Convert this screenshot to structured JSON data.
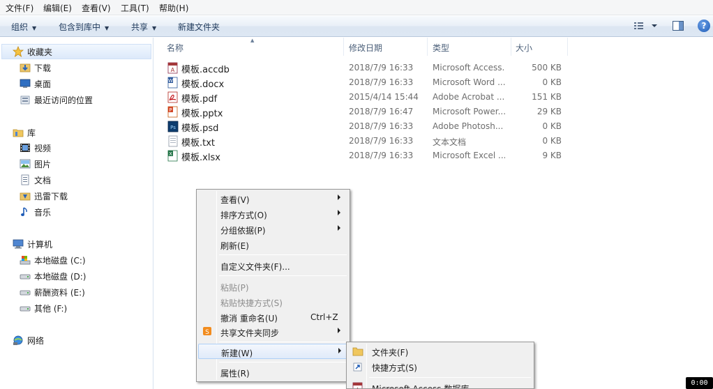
{
  "menubar": {
    "items": [
      "文件(F)",
      "编辑(E)",
      "查看(V)",
      "工具(T)",
      "帮助(H)"
    ]
  },
  "commandbar": {
    "organize": "组织",
    "include_in_library": "包含到库中",
    "share": "共享",
    "new_folder": "新建文件夹",
    "help": "?"
  },
  "nav": {
    "favorites": "收藏夹",
    "downloads": "下载",
    "desktop": "桌面",
    "recent": "最近访问的位置",
    "libraries": "库",
    "videos": "视频",
    "pictures": "图片",
    "documents": "文档",
    "thunder": "迅雷下载",
    "music": "音乐",
    "computer": "计算机",
    "drive_c": "本地磁盘 (C:)",
    "drive_d": "本地磁盘 (D:)",
    "drive_e": "薪酬资料 (E:)",
    "drive_f": "其他 (F:)",
    "network": "网络"
  },
  "columns": {
    "name": "名称",
    "modified": "修改日期",
    "type": "类型",
    "size": "大小"
  },
  "files": [
    {
      "name": "模板.accdb",
      "date": "2018/7/9 16:33",
      "type": "Microsoft Access...",
      "size": "500 KB",
      "icon": "access-icon"
    },
    {
      "name": "模板.docx",
      "date": "2018/7/9 16:33",
      "type": "Microsoft Word ...",
      "size": "0 KB",
      "icon": "word-icon"
    },
    {
      "name": "模板.pdf",
      "date": "2015/4/14 15:44",
      "type": "Adobe Acrobat ...",
      "size": "151 KB",
      "icon": "pdf-icon"
    },
    {
      "name": "模板.pptx",
      "date": "2018/7/9 16:47",
      "type": "Microsoft Power...",
      "size": "29 KB",
      "icon": "powerpoint-icon"
    },
    {
      "name": "模板.psd",
      "date": "2018/7/9 16:33",
      "type": "Adobe Photosh...",
      "size": "0 KB",
      "icon": "photoshop-icon"
    },
    {
      "name": "模板.txt",
      "date": "2018/7/9 16:33",
      "type": "文本文档",
      "size": "0 KB",
      "icon": "text-file-icon"
    },
    {
      "name": "模板.xlsx",
      "date": "2018/7/9 16:33",
      "type": "Microsoft Excel ...",
      "size": "9 KB",
      "icon": "excel-icon"
    }
  ],
  "context_menu": {
    "view": "查看(V)",
    "sort_by": "排序方式(O)",
    "group_by": "分组依据(P)",
    "refresh": "刷新(E)",
    "customize_folder": "自定义文件夹(F)...",
    "paste": "粘贴(P)",
    "paste_shortcut": "粘贴快捷方式(S)",
    "undo_rename": "撤消 重命名(U)",
    "undo_shortcut": "Ctrl+Z",
    "share_sync": "共享文件夹同步",
    "new": "新建(W)",
    "properties": "属性(R)"
  },
  "new_submenu": {
    "folder": "文件夹(F)",
    "shortcut": "快捷方式(S)",
    "access_db": "Microsoft Access 数据库"
  },
  "timer": "0:00",
  "colors": {
    "menu_bg": "#f0f0f0",
    "highlight_border": "#aecff7",
    "cmdbar_text": "#1e395b"
  }
}
